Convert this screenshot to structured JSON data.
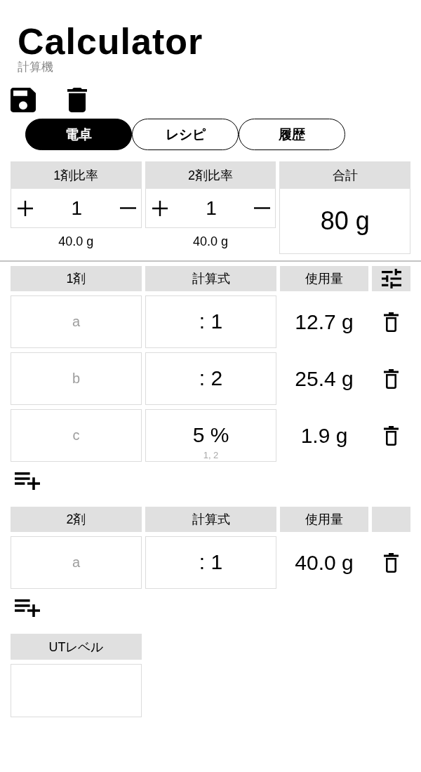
{
  "header": {
    "title": "Calculator",
    "subtitle": "計算機"
  },
  "tabs": [
    {
      "label": "電卓",
      "selected": true
    },
    {
      "label": "レシピ",
      "selected": false
    },
    {
      "label": "履歴",
      "selected": false
    }
  ],
  "ratios": [
    {
      "label": "1剤比率",
      "value": "1",
      "amount": "40.0 g"
    },
    {
      "label": "2剤比率",
      "value": "1",
      "amount": "40.0 g"
    }
  ],
  "total": {
    "label": "合計",
    "value": "80 g"
  },
  "tables": [
    {
      "columns": [
        "1剤",
        "計算式",
        "使用量"
      ],
      "settings": true,
      "rows": [
        {
          "placeholder": "a",
          "formula": ": 1",
          "amount": "12.7 g"
        },
        {
          "placeholder": "b",
          "formula": ": 2",
          "amount": "25.4 g"
        },
        {
          "placeholder": "c",
          "formula": "5 %",
          "note": "1, 2",
          "amount": "1.9 g"
        }
      ]
    },
    {
      "columns": [
        "2剤",
        "計算式",
        "使用量"
      ],
      "settings": false,
      "rows": [
        {
          "placeholder": "a",
          "formula": ": 1",
          "amount": "40.0 g"
        }
      ]
    }
  ],
  "ut_level": {
    "label": "UTレベル"
  }
}
